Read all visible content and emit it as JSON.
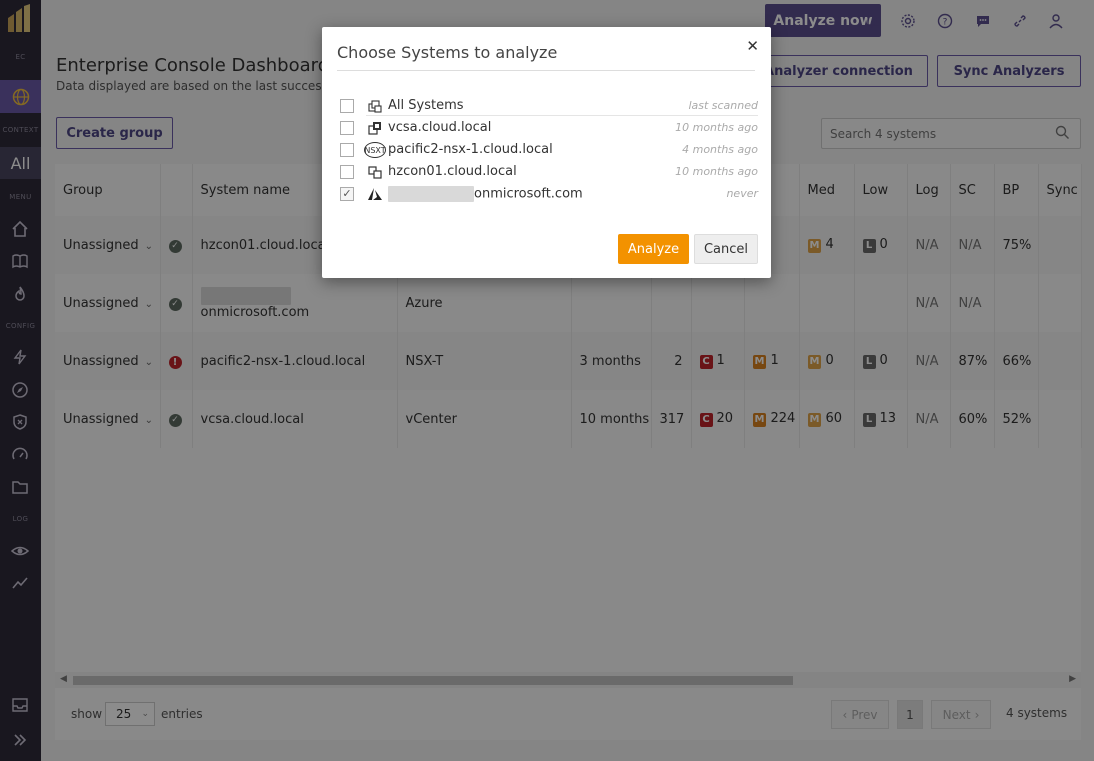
{
  "sidebar": {
    "ec_label": "EC",
    "context_label": "CONTEXT",
    "all_label": "All",
    "menu_label": "MENU",
    "config_label": "CONFIG",
    "log_label": "LOG"
  },
  "topbar": {
    "analyze_now_label": "Analyze now"
  },
  "header": {
    "title": "Enterprise Console Dashboard",
    "subtitle": "Data displayed are based on the last successf",
    "add_connection_label": "l Analyzer connection",
    "sync_label": "Sync Analyzers",
    "create_group_label": "Create group",
    "search_placeholder": "Search 4 systems"
  },
  "table": {
    "columns": [
      "Group",
      "",
      "System name",
      "",
      "",
      "",
      "",
      "",
      "Med",
      "Low",
      "Log",
      "SC",
      "BP",
      "Sync"
    ],
    "rows": [
      {
        "group": "Unassigned",
        "status": "ok",
        "name": "hzcon01.cloud.local",
        "type": "",
        "last": "",
        "count": "",
        "crit": "",
        "major": "",
        "med": "4",
        "low": "0",
        "log": "N/A",
        "sc": "N/A",
        "bp": "75%"
      },
      {
        "group": "Unassigned",
        "status": "ok",
        "name": "onmicrosoft.com",
        "type": "Azure",
        "last": "",
        "count": "",
        "crit": "",
        "major": "",
        "med": "",
        "low": "",
        "log": "N/A",
        "sc": "N/A",
        "bp": ""
      },
      {
        "group": "Unassigned",
        "status": "err",
        "name": "pacific2-nsx-1.cloud.local",
        "type": "NSX-T",
        "last": "3 months",
        "count": "2",
        "crit": "1",
        "major": "1",
        "med": "0",
        "low": "0",
        "log": "N/A",
        "sc": "87%",
        "bp": "66%"
      },
      {
        "group": "Unassigned",
        "status": "ok",
        "name": "vcsa.cloud.local",
        "type": "vCenter",
        "last": "10 months",
        "count": "317",
        "crit": "20",
        "major": "224",
        "med": "60",
        "low": "13",
        "log": "N/A",
        "sc": "60%",
        "bp": "52%"
      }
    ],
    "badge_c": "C",
    "badge_m": "M",
    "badge_l": "L"
  },
  "footer": {
    "show_label": "show",
    "entries_value": "25",
    "entries_label": "entries",
    "prev_label": "Prev",
    "page_label": "1",
    "next_label": "Next",
    "count_label": "4 systems"
  },
  "modal": {
    "title": "Choose Systems to analyze",
    "close_glyph": "✕",
    "header_row": {
      "name": "All Systems",
      "time": "last scanned"
    },
    "items": [
      {
        "name": "vcsa.cloud.local",
        "time": "10 months ago",
        "checked": false,
        "icon": "vcenter-icon"
      },
      {
        "name": "pacific2-nsx-1.cloud.local",
        "time": "4 months ago",
        "checked": false,
        "icon": "nsxt-icon",
        "icon_text": "NSXT"
      },
      {
        "name": "hzcon01.cloud.local",
        "time": "10 months ago",
        "checked": false,
        "icon": "horizon-icon"
      },
      {
        "name": "onmicrosoft.com",
        "time": "never",
        "checked": true,
        "icon": "azure-icon"
      }
    ],
    "analyze_label": "Analyze",
    "cancel_label": "Cancel"
  },
  "colors": {
    "accent": "#5c4f8f",
    "sidebar": "#2e2a3a",
    "orange": "#f39200",
    "critical": "#c0232b"
  }
}
